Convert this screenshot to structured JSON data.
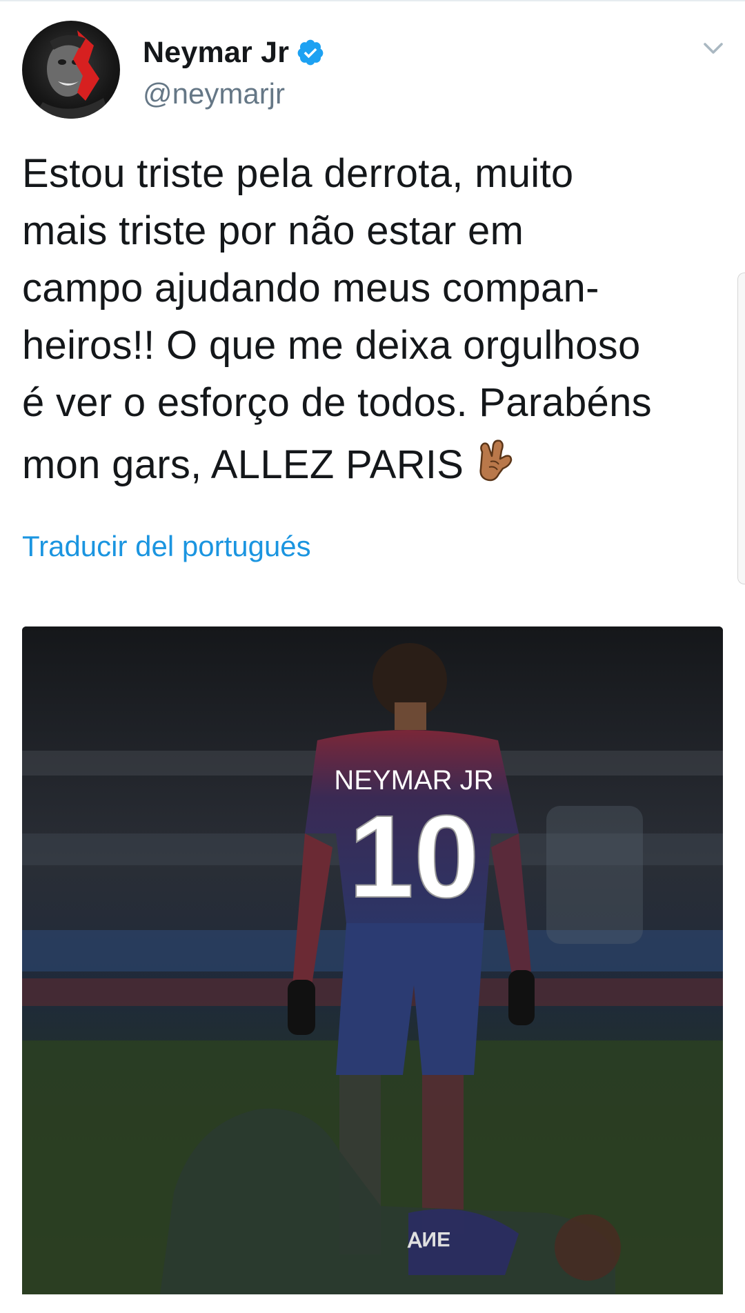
{
  "author": {
    "display_name": "Neymar Jr",
    "handle": "@neymarjr",
    "verified": true,
    "avatar_icon": "avatar"
  },
  "tweet": {
    "text_lines": [
      "Estou triste pela derrota, muito",
      "mais triste por não estar em",
      "campo ajudando meus compan-",
      "heiros!! O que me deixa orgulhoso",
      "é ver o esforço de todos. Parabéns",
      "mon gars, ALLEZ PARIS"
    ],
    "emoji": "call-me-hand-emoji",
    "translate_label": "Traducir del portugués"
  },
  "media": {
    "jersey_name": "NEYMAR JR",
    "jersey_number": "10",
    "overlay_number_reversed": "ƎИ∀"
  },
  "icons": {
    "caret": "chevron-down-icon",
    "verified": "verified-badge-icon"
  },
  "colors": {
    "link": "#1b95e0",
    "verified": "#1da1f2",
    "secondary_text": "#657786",
    "primary_text": "#14171a"
  }
}
